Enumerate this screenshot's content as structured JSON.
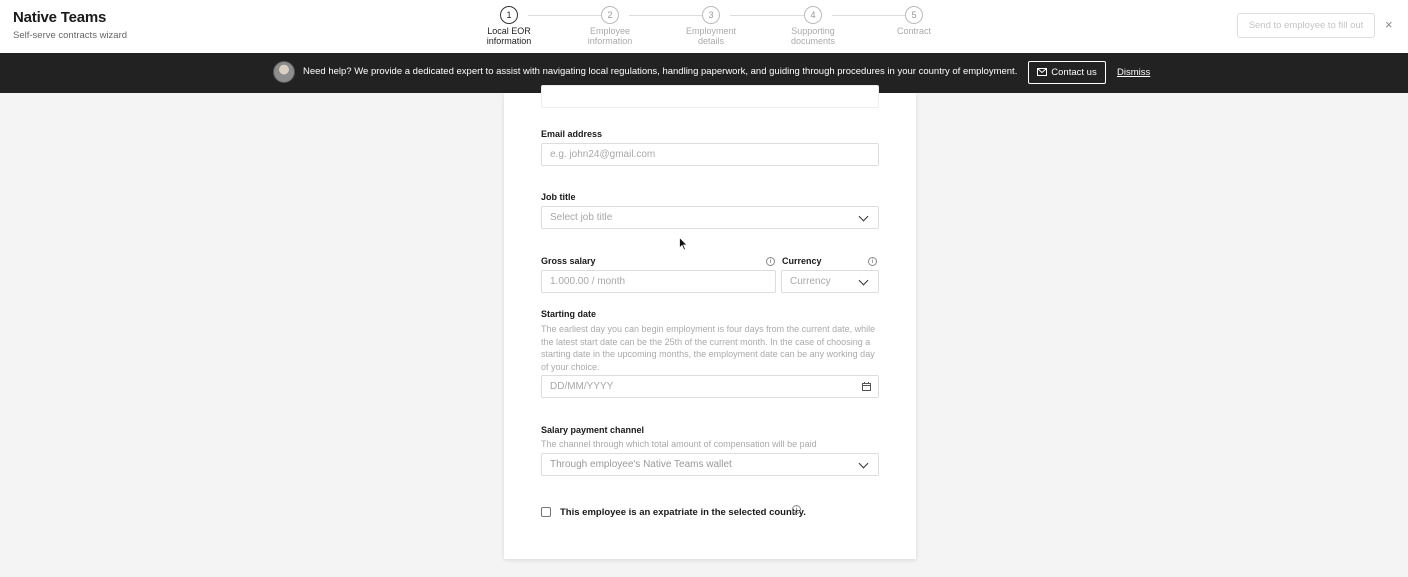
{
  "brand": {
    "title": "Native Teams",
    "subtitle": "Self-serve contracts wizard"
  },
  "steps": [
    {
      "number": "1",
      "label_line1": "Local EOR",
      "label_line2": "information",
      "active": true
    },
    {
      "number": "2",
      "label_line1": "Employee",
      "label_line2": "information",
      "active": false
    },
    {
      "number": "3",
      "label_line1": "Employment",
      "label_line2": "details",
      "active": false
    },
    {
      "number": "4",
      "label_line1": "Supporting",
      "label_line2": "documents",
      "active": false
    },
    {
      "number": "5",
      "label_line1": "Contract",
      "label_line2": "",
      "active": false
    }
  ],
  "header": {
    "send_button": "Send to employee to fill out",
    "close": "×"
  },
  "banner": {
    "text": "Need help? We provide a dedicated expert to assist with navigating local regulations, handling paperwork, and guiding through procedures in your country of employment.",
    "contact_button": "Contact us",
    "dismiss": "Dismiss"
  },
  "form": {
    "email": {
      "label": "Email address",
      "placeholder": "e.g. john24@gmail.com"
    },
    "job_title": {
      "label": "Job title",
      "placeholder": "Select job title"
    },
    "gross_salary": {
      "label": "Gross salary",
      "placeholder": "1.000.00 / month"
    },
    "currency": {
      "label": "Currency",
      "placeholder": "Currency"
    },
    "starting_date": {
      "label": "Starting date",
      "help": "The earliest day you can begin employment is four days from the current date, while the latest start date can be the 25th of the current month. In the case of choosing a starting date in the upcoming months, the employment date can be any working day of your choice.",
      "placeholder": "DD/MM/YYYY"
    },
    "salary_channel": {
      "label": "Salary payment channel",
      "help": "The channel through which total amount of compensation will be paid",
      "value": "Through employee's Native Teams wallet"
    },
    "expatriate": {
      "label": "This employee is an expatriate in the selected country.",
      "checked": false
    }
  }
}
